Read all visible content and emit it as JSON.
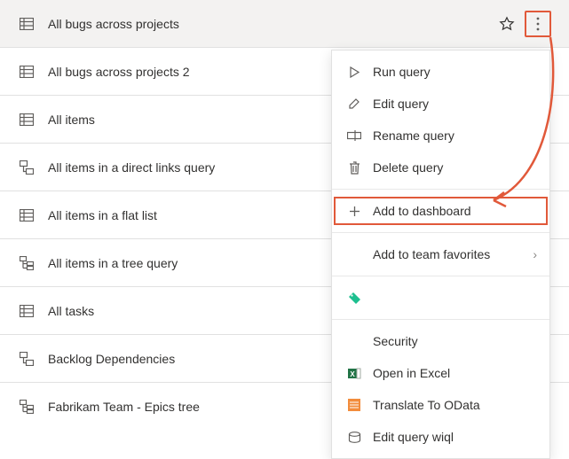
{
  "queries": [
    {
      "label": "All bugs across projects",
      "icon": "flat",
      "selected": true,
      "starred": false
    },
    {
      "label": "All bugs across projects 2",
      "icon": "flat"
    },
    {
      "label": "All items",
      "icon": "flat"
    },
    {
      "label": "All items in a direct links query",
      "icon": "linked"
    },
    {
      "label": "All items in a flat list",
      "icon": "flat"
    },
    {
      "label": "All items in a tree query",
      "icon": "tree"
    },
    {
      "label": "All tasks",
      "icon": "flat"
    },
    {
      "label": "Backlog Dependencies",
      "icon": "linked"
    },
    {
      "label": "Fabrikam Team - Epics tree",
      "icon": "tree"
    }
  ],
  "menu": {
    "run": "Run query",
    "edit": "Edit query",
    "rename": "Rename query",
    "delete": "Delete query",
    "add_dash": "Add to dashboard",
    "team_fav": "Add to team favorites",
    "security": "Security",
    "excel": "Open in Excel",
    "odata": "Translate To OData",
    "wiql": "Edit query wiql"
  },
  "icons": {
    "star": "☆",
    "more": "⋮",
    "chevron": "›"
  },
  "colors": {
    "annotation": "#e1593a",
    "tag_green": "#1dbf8f",
    "excel_green": "#217346",
    "odata_orange": "#f28c3c"
  }
}
